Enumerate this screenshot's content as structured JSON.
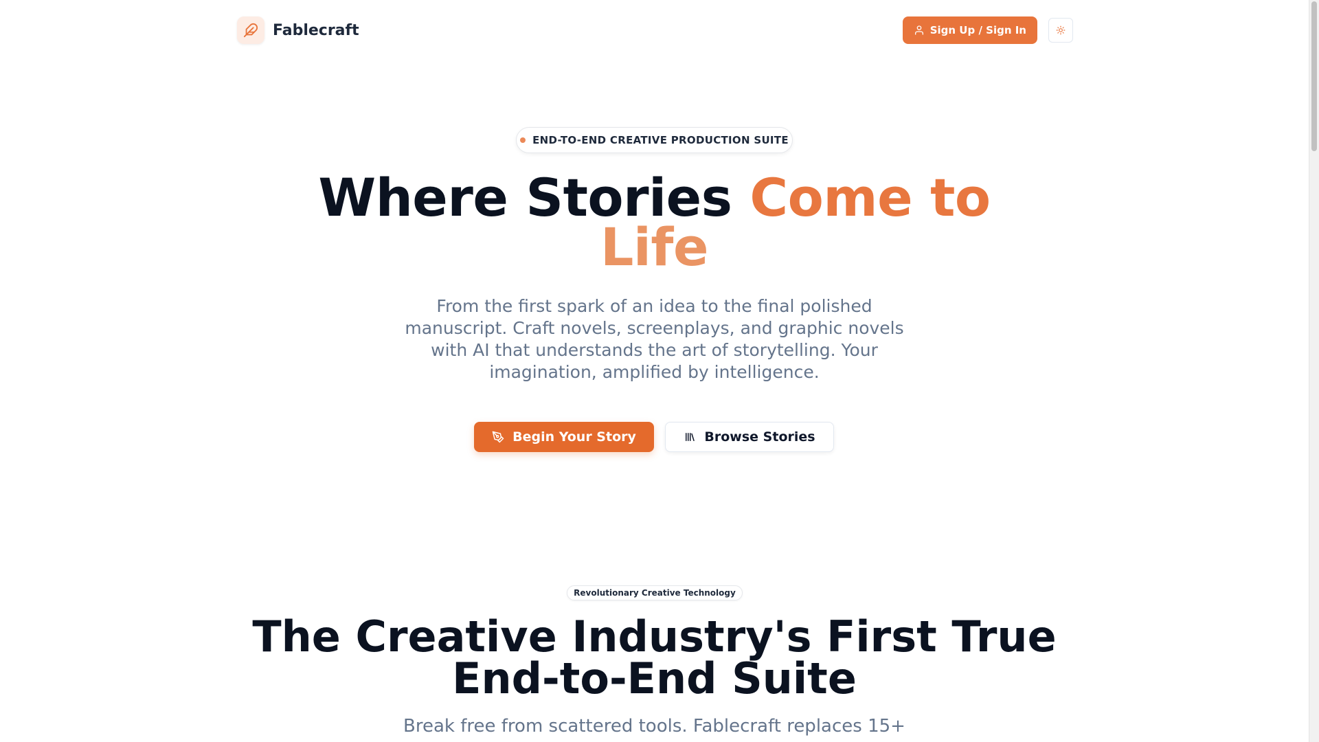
{
  "header": {
    "brand_name": "Fablecraft",
    "signup_label": "Sign Up / Sign In"
  },
  "hero": {
    "badge": "END-TO-END CREATIVE PRODUCTION SUITE",
    "title_plain": "Where Stories ",
    "title_accent_1": "Come to",
    "title_accent_2": "Life",
    "subtitle": "From the first spark of an idea to the final polished manuscript. Craft novels, screenplays, and graphic novels with AI that understands the art of storytelling. Your imagination, amplified by intelligence.",
    "primary_cta": "Begin Your Story",
    "secondary_cta": "Browse Stories"
  },
  "features": {
    "badge": "Revolutionary Creative Technology",
    "title_line_1": "The Creative Industry's First True",
    "title_line_2": "End-to-End Suite",
    "subtitle": "Break free from scattered tools. Fablecraft replaces 15+"
  },
  "colors": {
    "accent": "#e8743b",
    "accent_light": "#ea9463",
    "text_dark": "#0b1220",
    "text_muted": "#64748b"
  },
  "icons": {
    "brand": "feather-icon",
    "signup": "user-icon",
    "theme": "sun-icon",
    "primary_cta": "pen-nib-icon",
    "secondary_cta": "library-icon"
  }
}
